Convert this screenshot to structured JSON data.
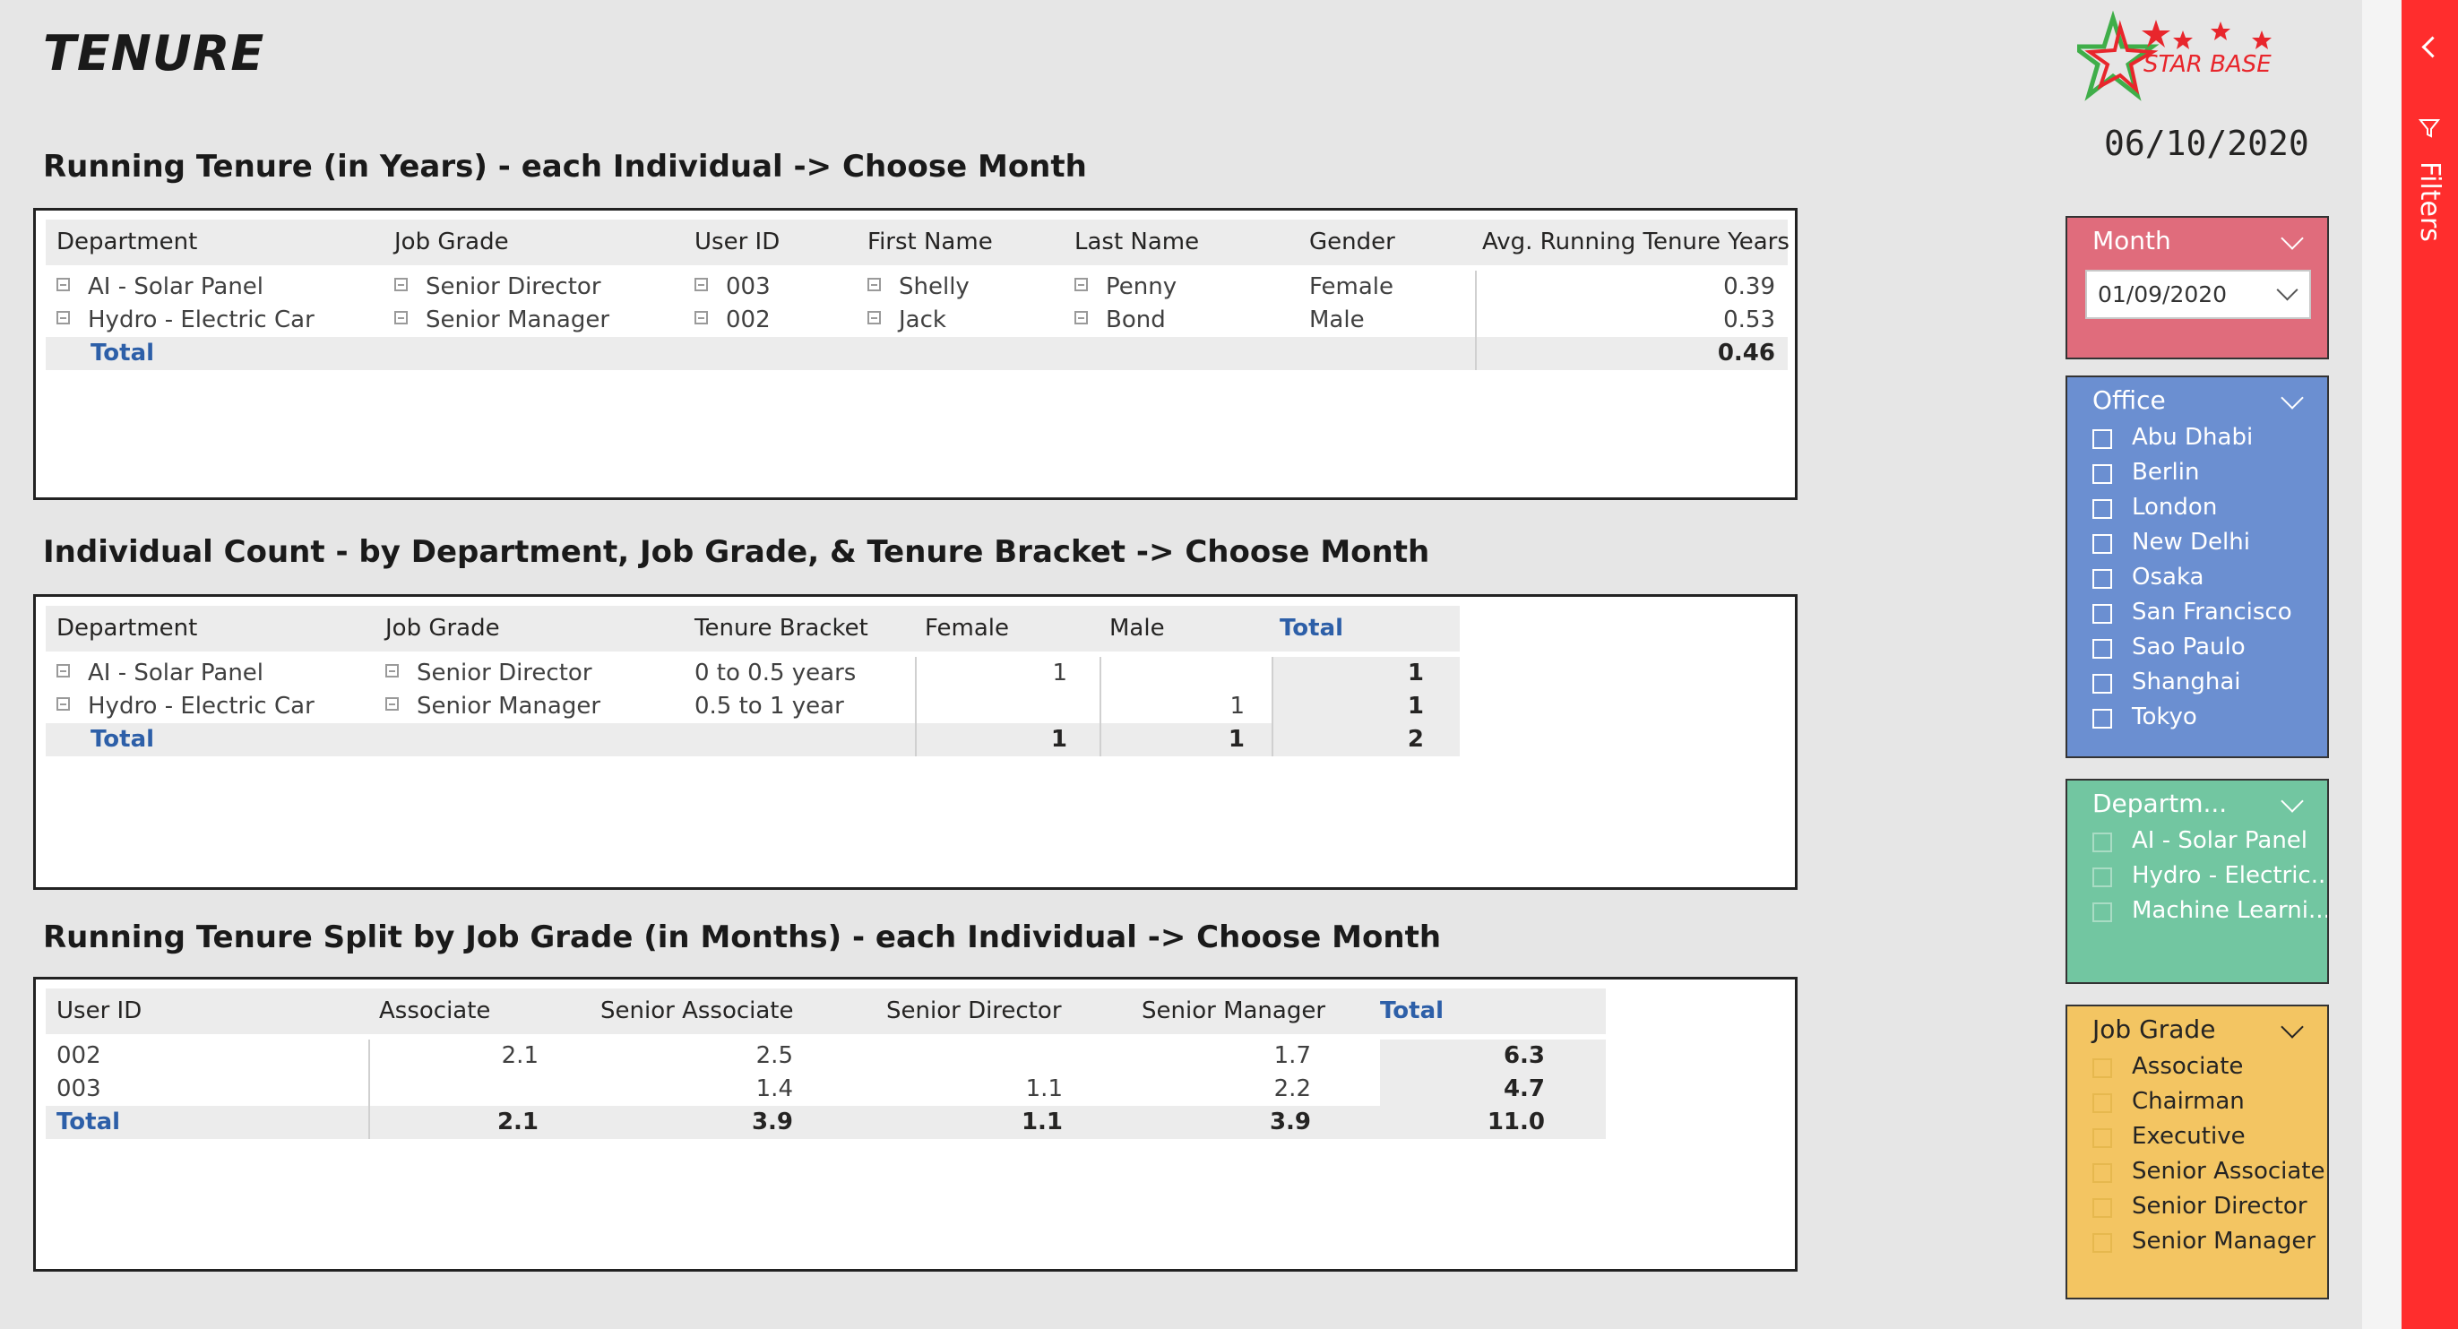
{
  "page_title": "TENURE",
  "report_date": "06/10/2020",
  "logo_text": "STAR BASE",
  "section1": {
    "title": "Running Tenure (in Years) - each Individual -> Choose Month",
    "headers": [
      "Department",
      "Job Grade",
      "User ID",
      "First Name",
      "Last Name",
      "Gender",
      "Avg. Running Tenure Years"
    ],
    "rows": [
      {
        "dept": "AI - Solar Panel",
        "grade": "Senior Director",
        "user": "003",
        "first": "Shelly",
        "last": "Penny",
        "gender": "Female",
        "value": "0.39"
      },
      {
        "dept": "Hydro - Electric Car",
        "grade": "Senior Manager",
        "user": "002",
        "first": "Jack",
        "last": "Bond",
        "gender": "Male",
        "value": "0.53"
      }
    ],
    "total_label": "Total",
    "total_value": "0.46"
  },
  "section2": {
    "title": "Individual Count - by Department, Job Grade, & Tenure Bracket -> Choose Month",
    "headers": [
      "Department",
      "Job Grade",
      "Tenure Bracket",
      "Female",
      "Male",
      "Total"
    ],
    "rows": [
      {
        "dept": "AI - Solar Panel",
        "grade": "Senior Director",
        "bracket": "0 to 0.5 years",
        "female": "1",
        "male": "",
        "total": "1"
      },
      {
        "dept": "Hydro - Electric Car",
        "grade": "Senior Manager",
        "bracket": "0.5 to 1 year",
        "female": "",
        "male": "1",
        "total": "1"
      }
    ],
    "total_label": "Total",
    "totals": {
      "female": "1",
      "male": "1",
      "total": "2"
    }
  },
  "section3": {
    "title": "Running Tenure Split by Job Grade (in Months) - each Individual -> Choose Month",
    "headers": [
      "User ID",
      "Associate",
      "Senior Associate",
      "Senior Director",
      "Senior Manager",
      "Total"
    ],
    "rows": [
      {
        "user": "002",
        "associate": "2.1",
        "senior_associate": "2.5",
        "senior_director": "",
        "senior_manager": "1.7",
        "total": "6.3"
      },
      {
        "user": "003",
        "associate": "",
        "senior_associate": "1.4",
        "senior_director": "1.1",
        "senior_manager": "2.2",
        "total": "4.7"
      }
    ],
    "total_label": "Total",
    "totals": {
      "associate": "2.1",
      "senior_associate": "3.9",
      "senior_director": "1.1",
      "senior_manager": "3.9",
      "total": "11.0"
    }
  },
  "slicers": {
    "month": {
      "title": "Month",
      "selected": "01/09/2020",
      "color": "#e06c7c"
    },
    "office": {
      "title": "Office",
      "color": "#6b8fd1",
      "items": [
        "Abu Dhabi",
        "Berlin",
        "London",
        "New Delhi",
        "Osaka",
        "San Francisco",
        "Sao Paulo",
        "Shanghai",
        "Tokyo"
      ]
    },
    "department": {
      "title": "Departm...",
      "color": "#72c6a1",
      "items": [
        "AI - Solar Panel",
        "Hydro - Electric...",
        "Machine Learni..."
      ]
    },
    "job_grade": {
      "title": "Job Grade",
      "color": "#f3c562",
      "items": [
        "Associate",
        "Chairman",
        "Executive",
        "Senior Associate",
        "Senior Director",
        "Senior Manager"
      ]
    }
  },
  "filters_pane": {
    "label": "Filters",
    "color": "#ff2d2d"
  }
}
